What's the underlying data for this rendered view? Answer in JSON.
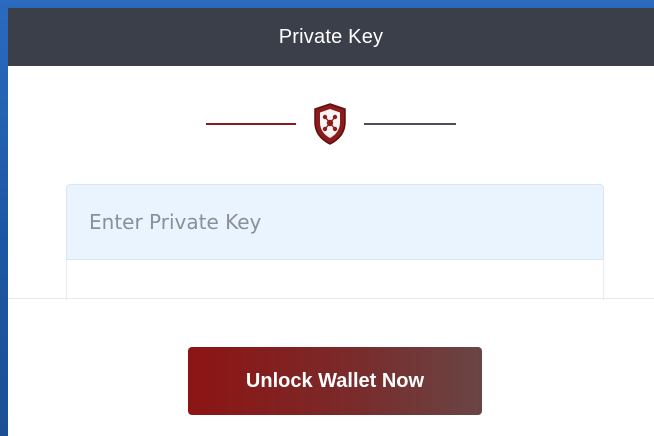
{
  "modal": {
    "title": "Private Key"
  },
  "divider": {
    "icon": "shield-network-icon",
    "left_line_color": "#8b1a1a",
    "right_line_color": "#4a4e57"
  },
  "private_key_input": {
    "placeholder": "Enter Private Key",
    "value": ""
  },
  "unlock_button": {
    "label": "Unlock Wallet Now"
  },
  "colors": {
    "header_bg": "#3b3f4a",
    "accent_red": "#8d1414",
    "input_bg": "#e9f4ff",
    "page_border": "#1f5aa8"
  }
}
